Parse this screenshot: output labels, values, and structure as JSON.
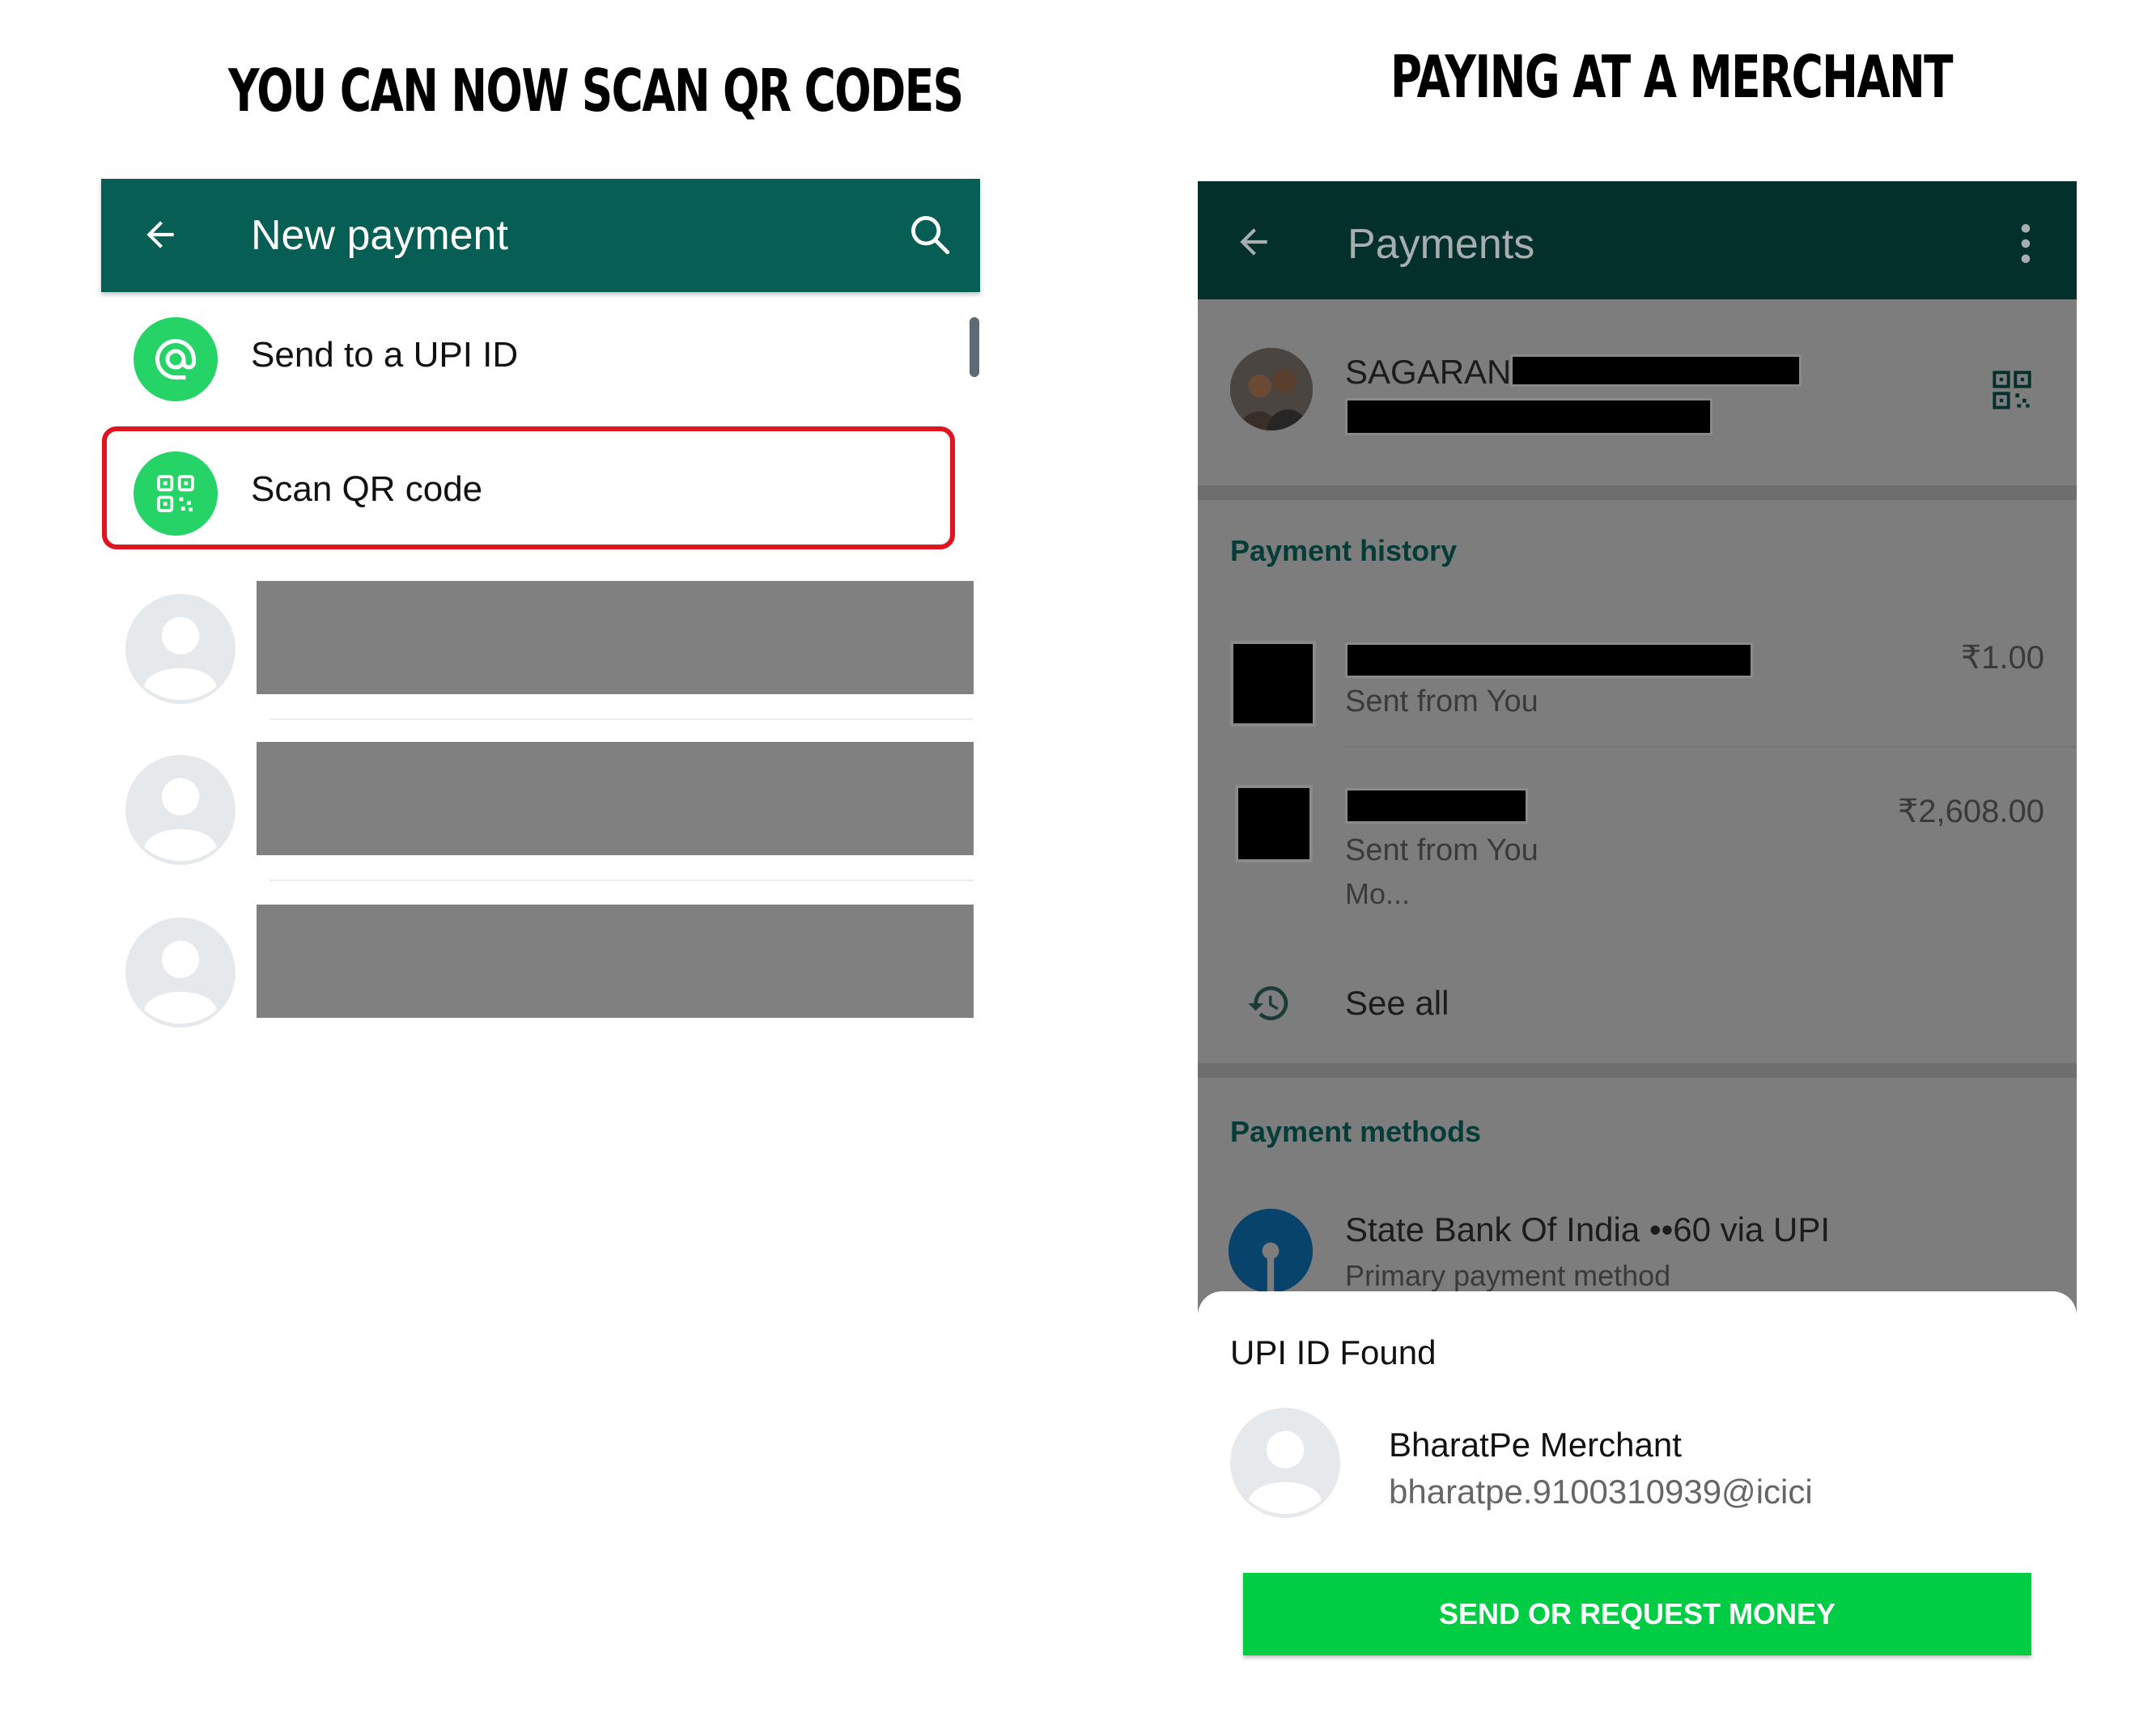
{
  "captions": {
    "left": "YOU CAN NOW SCAN QR CODES",
    "right": "PAYING AT A MERCHANT"
  },
  "left_screen": {
    "header": {
      "title": "New payment",
      "back_icon": "arrow-left-icon",
      "search_icon": "search-icon",
      "color": "#075e54"
    },
    "menu": [
      {
        "label": "Send to a UPI ID",
        "icon": "at-sign-icon"
      },
      {
        "label": "Scan QR code",
        "icon": "qr-code-icon",
        "highlighted": true
      }
    ],
    "highlight_color": "#e0141e",
    "accent": "#25d366",
    "contacts_redacted": 3
  },
  "right_screen": {
    "header": {
      "title": "Payments",
      "back_icon": "arrow-left-icon",
      "menu_icon": "more-vert-icon"
    },
    "profile": {
      "name": "SAGARAN",
      "qr_icon": "qr-code-icon"
    },
    "payment_history": {
      "title": "Payment history",
      "transactions": [
        {
          "subtitle": "Sent from You",
          "amount": "₹1.00"
        },
        {
          "subtitle": "Sent from You",
          "note": "Mo...",
          "amount": "₹2,608.00"
        }
      ],
      "see_all": "See all",
      "see_all_icon": "history-icon"
    },
    "payment_methods": {
      "title": "Payment methods",
      "bank": "State Bank Of India ••60 via UPI",
      "bank_sub": "Primary payment method"
    },
    "sheet": {
      "title": "UPI ID Found",
      "merchant_name": "BharatPe Merchant",
      "merchant_upi": "bharatpe.9100310939@icici",
      "button": "SEND OR REQUEST MONEY",
      "button_color": "#00cc44"
    }
  }
}
